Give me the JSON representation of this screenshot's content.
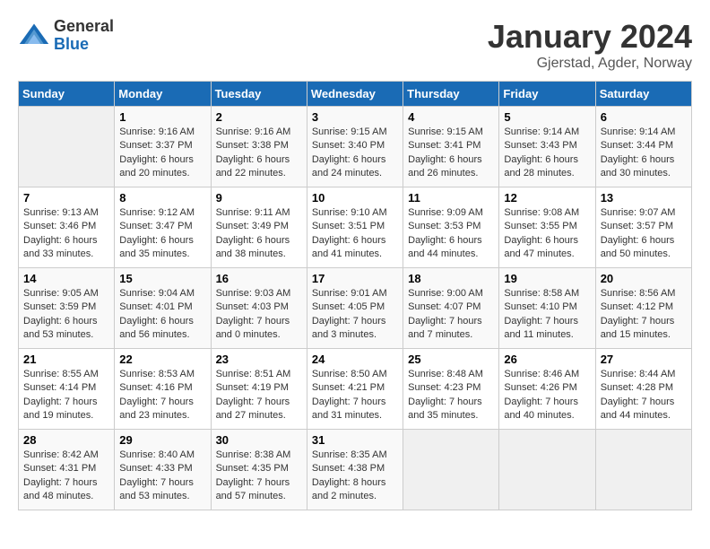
{
  "header": {
    "logo": {
      "general": "General",
      "blue": "Blue"
    },
    "title": "January 2024",
    "subtitle": "Gjerstad, Agder, Norway"
  },
  "days_of_week": [
    "Sunday",
    "Monday",
    "Tuesday",
    "Wednesday",
    "Thursday",
    "Friday",
    "Saturday"
  ],
  "weeks": [
    [
      {
        "day": "",
        "info": ""
      },
      {
        "day": "1",
        "info": "Sunrise: 9:16 AM\nSunset: 3:37 PM\nDaylight: 6 hours\nand 20 minutes."
      },
      {
        "day": "2",
        "info": "Sunrise: 9:16 AM\nSunset: 3:38 PM\nDaylight: 6 hours\nand 22 minutes."
      },
      {
        "day": "3",
        "info": "Sunrise: 9:15 AM\nSunset: 3:40 PM\nDaylight: 6 hours\nand 24 minutes."
      },
      {
        "day": "4",
        "info": "Sunrise: 9:15 AM\nSunset: 3:41 PM\nDaylight: 6 hours\nand 26 minutes."
      },
      {
        "day": "5",
        "info": "Sunrise: 9:14 AM\nSunset: 3:43 PM\nDaylight: 6 hours\nand 28 minutes."
      },
      {
        "day": "6",
        "info": "Sunrise: 9:14 AM\nSunset: 3:44 PM\nDaylight: 6 hours\nand 30 minutes."
      }
    ],
    [
      {
        "day": "7",
        "info": "Sunrise: 9:13 AM\nSunset: 3:46 PM\nDaylight: 6 hours\nand 33 minutes."
      },
      {
        "day": "8",
        "info": "Sunrise: 9:12 AM\nSunset: 3:47 PM\nDaylight: 6 hours\nand 35 minutes."
      },
      {
        "day": "9",
        "info": "Sunrise: 9:11 AM\nSunset: 3:49 PM\nDaylight: 6 hours\nand 38 minutes."
      },
      {
        "day": "10",
        "info": "Sunrise: 9:10 AM\nSunset: 3:51 PM\nDaylight: 6 hours\nand 41 minutes."
      },
      {
        "day": "11",
        "info": "Sunrise: 9:09 AM\nSunset: 3:53 PM\nDaylight: 6 hours\nand 44 minutes."
      },
      {
        "day": "12",
        "info": "Sunrise: 9:08 AM\nSunset: 3:55 PM\nDaylight: 6 hours\nand 47 minutes."
      },
      {
        "day": "13",
        "info": "Sunrise: 9:07 AM\nSunset: 3:57 PM\nDaylight: 6 hours\nand 50 minutes."
      }
    ],
    [
      {
        "day": "14",
        "info": "Sunrise: 9:05 AM\nSunset: 3:59 PM\nDaylight: 6 hours\nand 53 minutes."
      },
      {
        "day": "15",
        "info": "Sunrise: 9:04 AM\nSunset: 4:01 PM\nDaylight: 6 hours\nand 56 minutes."
      },
      {
        "day": "16",
        "info": "Sunrise: 9:03 AM\nSunset: 4:03 PM\nDaylight: 7 hours\nand 0 minutes."
      },
      {
        "day": "17",
        "info": "Sunrise: 9:01 AM\nSunset: 4:05 PM\nDaylight: 7 hours\nand 3 minutes."
      },
      {
        "day": "18",
        "info": "Sunrise: 9:00 AM\nSunset: 4:07 PM\nDaylight: 7 hours\nand 7 minutes."
      },
      {
        "day": "19",
        "info": "Sunrise: 8:58 AM\nSunset: 4:10 PM\nDaylight: 7 hours\nand 11 minutes."
      },
      {
        "day": "20",
        "info": "Sunrise: 8:56 AM\nSunset: 4:12 PM\nDaylight: 7 hours\nand 15 minutes."
      }
    ],
    [
      {
        "day": "21",
        "info": "Sunrise: 8:55 AM\nSunset: 4:14 PM\nDaylight: 7 hours\nand 19 minutes."
      },
      {
        "day": "22",
        "info": "Sunrise: 8:53 AM\nSunset: 4:16 PM\nDaylight: 7 hours\nand 23 minutes."
      },
      {
        "day": "23",
        "info": "Sunrise: 8:51 AM\nSunset: 4:19 PM\nDaylight: 7 hours\nand 27 minutes."
      },
      {
        "day": "24",
        "info": "Sunrise: 8:50 AM\nSunset: 4:21 PM\nDaylight: 7 hours\nand 31 minutes."
      },
      {
        "day": "25",
        "info": "Sunrise: 8:48 AM\nSunset: 4:23 PM\nDaylight: 7 hours\nand 35 minutes."
      },
      {
        "day": "26",
        "info": "Sunrise: 8:46 AM\nSunset: 4:26 PM\nDaylight: 7 hours\nand 40 minutes."
      },
      {
        "day": "27",
        "info": "Sunrise: 8:44 AM\nSunset: 4:28 PM\nDaylight: 7 hours\nand 44 minutes."
      }
    ],
    [
      {
        "day": "28",
        "info": "Sunrise: 8:42 AM\nSunset: 4:31 PM\nDaylight: 7 hours\nand 48 minutes."
      },
      {
        "day": "29",
        "info": "Sunrise: 8:40 AM\nSunset: 4:33 PM\nDaylight: 7 hours\nand 53 minutes."
      },
      {
        "day": "30",
        "info": "Sunrise: 8:38 AM\nSunset: 4:35 PM\nDaylight: 7 hours\nand 57 minutes."
      },
      {
        "day": "31",
        "info": "Sunrise: 8:35 AM\nSunset: 4:38 PM\nDaylight: 8 hours\nand 2 minutes."
      },
      {
        "day": "",
        "info": ""
      },
      {
        "day": "",
        "info": ""
      },
      {
        "day": "",
        "info": ""
      }
    ]
  ]
}
